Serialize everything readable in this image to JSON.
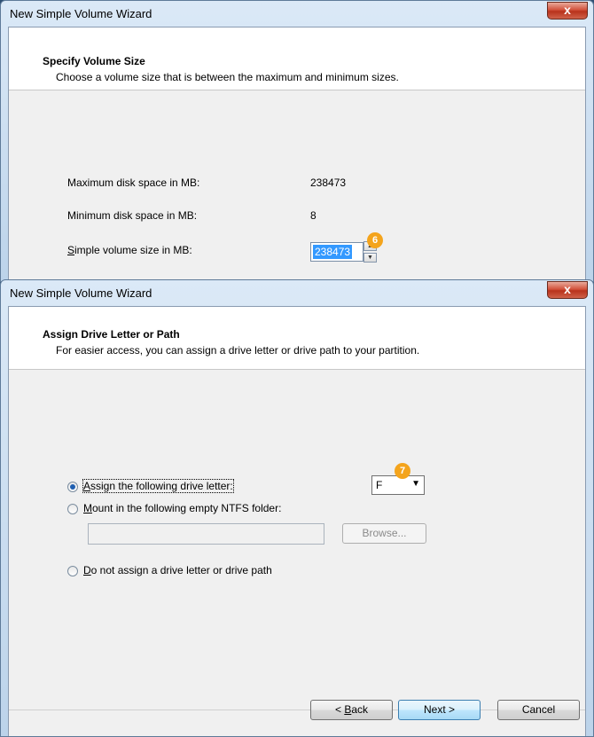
{
  "window1": {
    "title": "New Simple Volume Wizard",
    "close": "x",
    "header_title": "Specify Volume Size",
    "header_subtitle": "Choose a volume size that is between the maximum and minimum sizes.",
    "max_label": "Maximum disk space in MB:",
    "max_value": "238473",
    "min_label": "Minimum disk space in MB:",
    "min_value": "8",
    "size_label_u": "S",
    "size_label_rest": "imple volume size in MB:",
    "size_value": "238473",
    "badge": "6"
  },
  "window2": {
    "title": "New Simple Volume Wizard",
    "close": "x",
    "header_title": "Assign Drive Letter or Path",
    "header_subtitle": "For easier access, you can assign a drive letter or drive path to your partition.",
    "opt_assign_u": "A",
    "opt_assign_rest": "ssign the following drive letter:",
    "opt_mount_u": "M",
    "opt_mount_rest": "ount in the following empty NTFS folder:",
    "opt_none_u": "D",
    "opt_none_rest": "o not assign a drive letter or drive path",
    "drive_letter": "F",
    "browse": "Browse...",
    "back_prefix": "< ",
    "back_u": "B",
    "back_rest": "ack",
    "next": "Next >",
    "cancel": "Cancel",
    "badge": "7",
    "selected_option": "assign"
  }
}
